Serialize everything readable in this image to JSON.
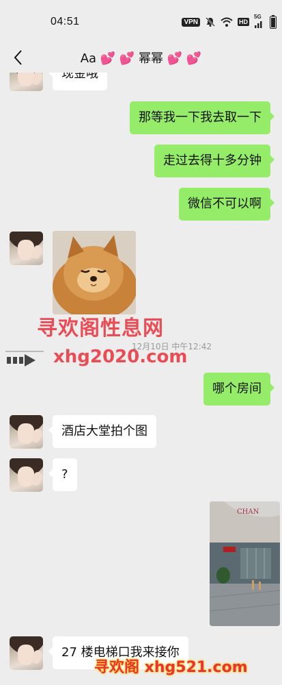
{
  "status_bar": {
    "time": "04:51",
    "vpn": "VPN",
    "hd": "HD",
    "signal": "5G",
    "icons": [
      "vpn-icon",
      "bell-off-icon",
      "wifi-icon",
      "hd-icon",
      "signal-icon",
      "battery-icon"
    ]
  },
  "nav": {
    "back_icon": "chevron-left-icon",
    "title": "Aa 💕 💕 幂幂 💕 💕"
  },
  "messages": [
    {
      "side": "left",
      "type": "text",
      "text": "现金哦"
    },
    {
      "side": "right",
      "type": "text",
      "text": "那等我一下我去取一下"
    },
    {
      "side": "right",
      "type": "text",
      "text": "走过去得十多分钟"
    },
    {
      "side": "right",
      "type": "text",
      "text": "微信不可以啊"
    },
    {
      "side": "left",
      "type": "image",
      "content": "pomeranian-dog-sticker"
    },
    {
      "type": "timestamp",
      "text": "12月10日 中午12:42"
    },
    {
      "side": "right",
      "type": "text",
      "text": "哪个房间"
    },
    {
      "side": "left",
      "type": "text",
      "text": "酒店大堂拍个图"
    },
    {
      "side": "left",
      "type": "text",
      "text": "?"
    },
    {
      "side": "right",
      "type": "image",
      "content": "hotel-lobby-photo"
    },
    {
      "side": "left",
      "type": "text",
      "text": "27 楼电梯口我来接你"
    }
  ],
  "watermarks": {
    "site_name": "寻欢阁性息网",
    "domain1": "xhg2020.com",
    "bottom": "寻欢阁 xhg521.com"
  },
  "colors": {
    "background": "#ededed",
    "bubble_right": "#95ec69",
    "bubble_left": "#ffffff",
    "watermark_red": "#e8323c"
  }
}
